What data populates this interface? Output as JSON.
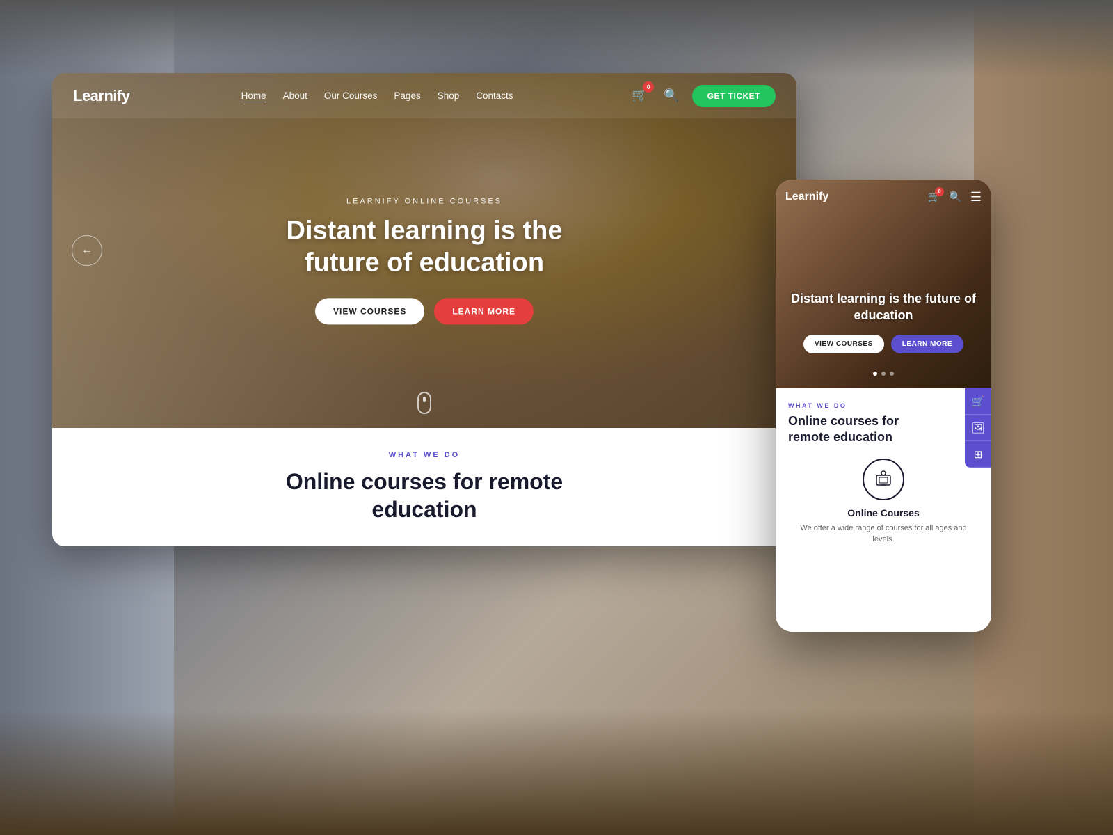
{
  "brand": {
    "name": "Learnify"
  },
  "navbar": {
    "links": [
      {
        "label": "Home",
        "active": true
      },
      {
        "label": "About",
        "active": false
      },
      {
        "label": "Our Courses",
        "active": false
      },
      {
        "label": "Pages",
        "active": false
      },
      {
        "label": "Shop",
        "active": false
      },
      {
        "label": "Contacts",
        "active": false
      }
    ],
    "cart_count": "0",
    "get_ticket_label": "GET TICKET",
    "search_icon": "🔍"
  },
  "hero": {
    "subtitle": "LEARNIFY ONLINE COURSES",
    "title": "Distant learning is the future of education",
    "btn_view": "VIEW COURSES",
    "btn_learn": "LEARN MORE"
  },
  "bottom": {
    "what_we_do": "WHAT WE DO",
    "title_line1": "Online courses for remote",
    "title_line2": "education"
  },
  "mobile": {
    "brand": "Learnify",
    "cart_count": "0",
    "hero_title": "Distant learning is the future of education",
    "btn_view": "VIEW COURSES",
    "btn_learn": "LEARN MORE",
    "what_we_do": "WHAT WE DO",
    "courses_title": "Online courses for\nremote education",
    "course_card": {
      "title": "Online Courses",
      "desc": "We offer a wide range of courses for all ages and levels."
    }
  },
  "colors": {
    "accent_purple": "#5b4fcf",
    "accent_red": "#e53e3e",
    "accent_green": "#22c55e",
    "dark": "#1a1a2e",
    "white": "#ffffff"
  }
}
